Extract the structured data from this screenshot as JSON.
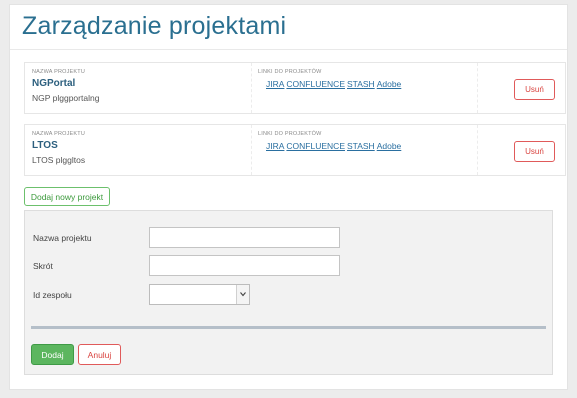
{
  "page": {
    "title": "Zarządzanie projektami"
  },
  "projects": [
    {
      "name_label": "NAZWA PROJEKTU",
      "name": "NGPortal",
      "short": "NGP plggportalng",
      "links_label": "LINKI DO PROJEKTÓW",
      "links": [
        "JIRA",
        "CONFLUENCE",
        "STASH",
        "Adobe"
      ],
      "remove_label": "Usuń"
    },
    {
      "name_label": "NAZWA PROJEKTU",
      "name": "LTOS",
      "short": "LTOS plggltos",
      "links_label": "LINKI DO PROJEKTÓW",
      "links": [
        "JIRA",
        "CONFLUENCE",
        "STASH",
        "Adobe"
      ],
      "remove_label": "Usuń"
    }
  ],
  "add_project_button": "Dodaj nowy projekt",
  "form": {
    "name_label": "Nazwa projektu",
    "name_value": "",
    "short_label": "Skrót",
    "short_value": "",
    "team_label": "Id zespołu",
    "team_value": "",
    "submit_label": "Dodaj",
    "cancel_label": "Anuluj"
  },
  "colors": {
    "title": "#2a6f90",
    "link": "#2a6fa0",
    "danger": "#d9433f",
    "success": "#5cb65f"
  },
  "icons": {
    "team_select": "chevron-down-icon"
  }
}
